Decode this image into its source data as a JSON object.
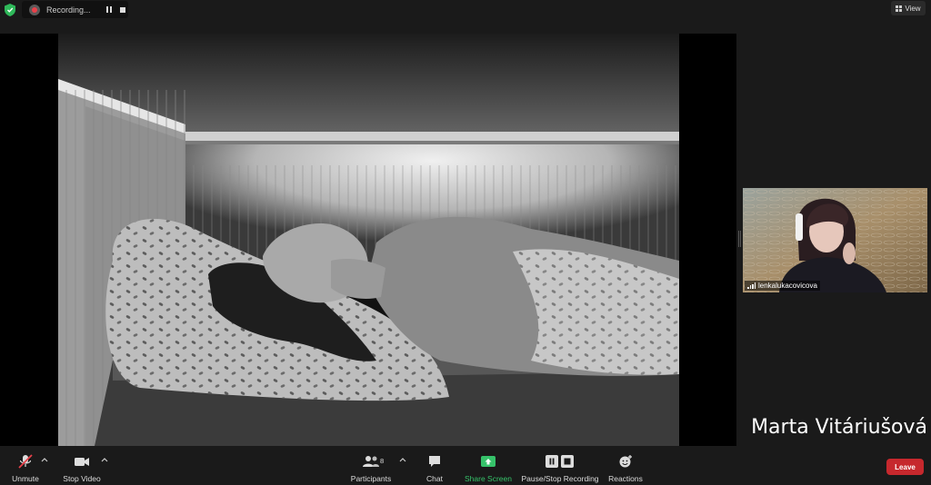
{
  "top_bar": {
    "recording_label": "Recording...",
    "view_label": "View",
    "shield_color": "#2fb95a"
  },
  "gallery": {
    "participant_name": "lenkalukacovicova",
    "speaker_name": "Marta Vitáriušová"
  },
  "toolbar": {
    "unmute_label": "Unmute",
    "stop_video_label": "Stop Video",
    "participants_label": "Participants",
    "participants_count": "8",
    "chat_label": "Chat",
    "share_screen_label": "Share Screen",
    "recording_label": "Pause/Stop Recording",
    "reactions_label": "Reactions",
    "leave_label": "Leave",
    "share_color": "#36c26a",
    "leave_color": "#c6282d",
    "muted_color": "#e8414a"
  }
}
